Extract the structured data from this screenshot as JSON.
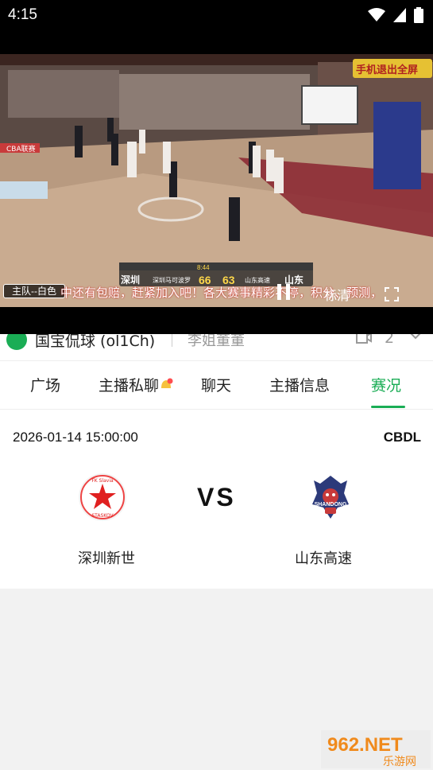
{
  "status_bar": {
    "time": "4:15"
  },
  "video": {
    "team_chip": "主队--白色",
    "danmaku": "中还有包赔，赶紧加入吧！各大赛事精彩不停，积分、预测，",
    "scoreboard": {
      "clock": "8:44",
      "home_abbr": "深圳",
      "home_team": "深圳马可波罗",
      "home_score": "66",
      "away_score": "63",
      "away_team": "山东高速",
      "away_abbr": "山东"
    },
    "quality_label": "标清",
    "corner_badge": "手机退出全屏",
    "sponsor_text": "CBA联赛"
  },
  "room": {
    "name": "国宝侃球 (ol1Ch)",
    "anchor": "李姐董董",
    "viewer_count": "2"
  },
  "tabs": [
    {
      "label": "广场"
    },
    {
      "label": "主播私聊"
    },
    {
      "label": "聊天"
    },
    {
      "label": "主播信息"
    },
    {
      "label": "赛况"
    }
  ],
  "match": {
    "datetime": "2026-01-14 15:00:00",
    "league": "CBDL",
    "vs_label": "VS",
    "home_team": "深圳新世",
    "away_team": "山东高速",
    "home_logo_text": {
      "top": "FK Slavia",
      "bottom": "STASKOV"
    },
    "away_logo_text": "SHANDONG"
  },
  "watermark": {
    "text": "962.NET",
    "sub": "乐游网"
  },
  "colors": {
    "accent": "#1aad55",
    "danmaku": "#ffffff"
  }
}
